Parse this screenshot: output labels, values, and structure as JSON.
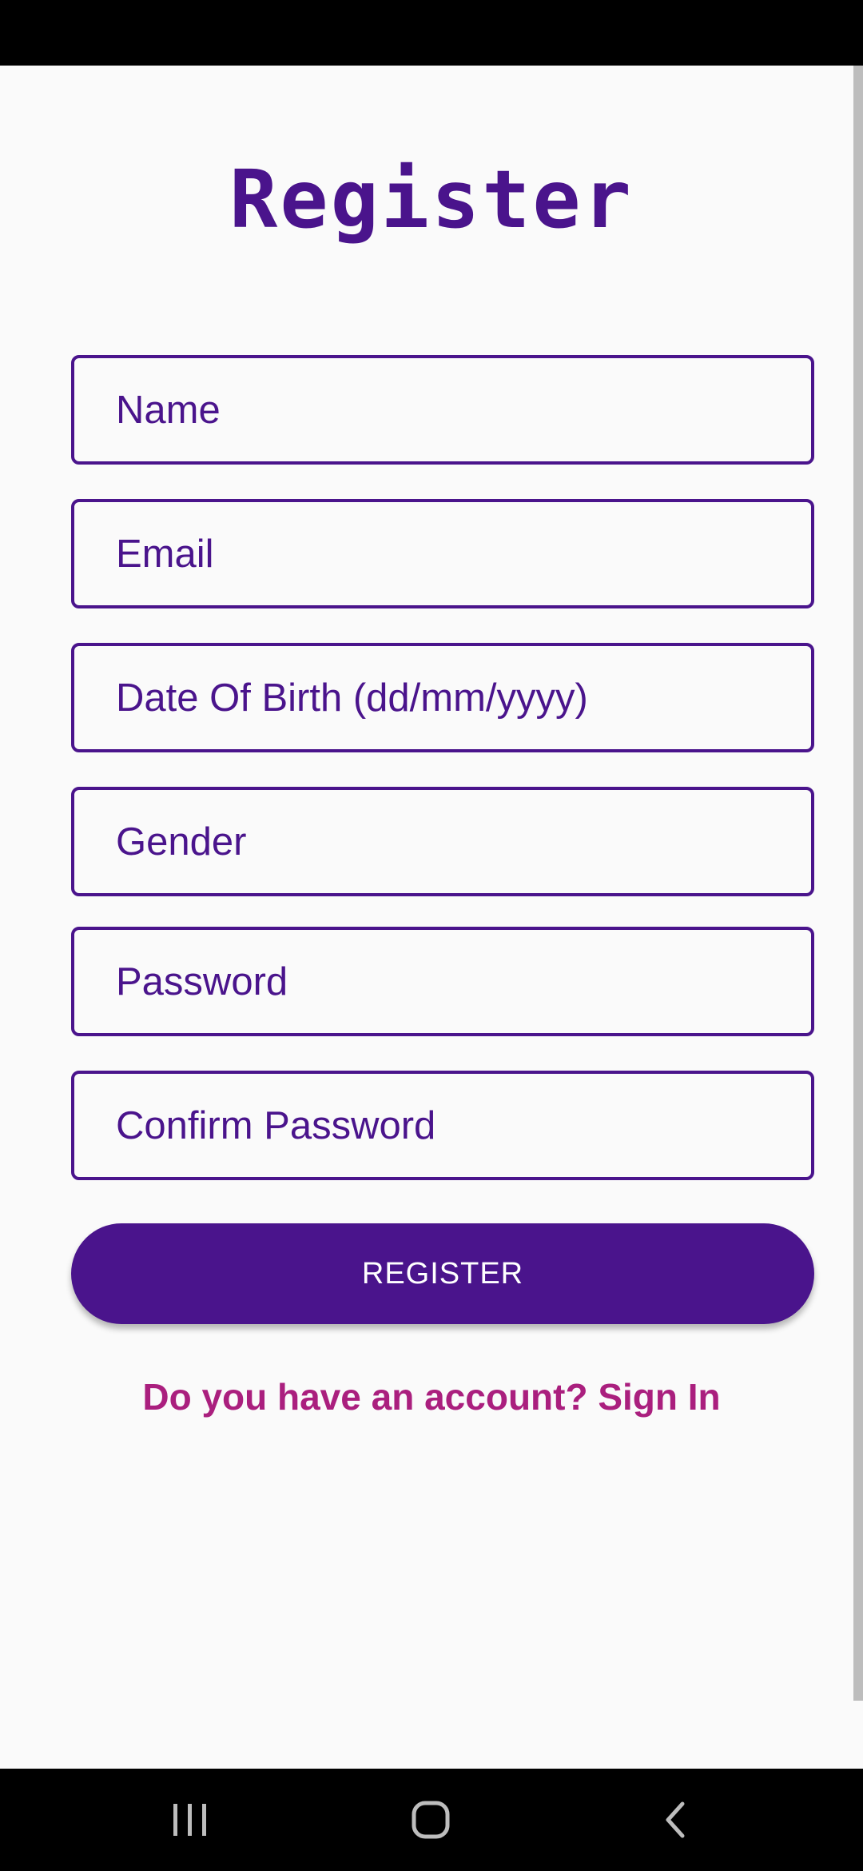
{
  "page": {
    "title": "Register"
  },
  "form": {
    "fields": [
      {
        "id": "name",
        "placeholder": "Name"
      },
      {
        "id": "email",
        "placeholder": "Email"
      },
      {
        "id": "dob",
        "placeholder": "Date Of Birth (dd/mm/yyyy)"
      },
      {
        "id": "gender",
        "placeholder": "Gender"
      },
      {
        "id": "password",
        "placeholder": "Password"
      },
      {
        "id": "confirm_password",
        "placeholder": "Confirm Password"
      }
    ],
    "submit_label": "REGISTER",
    "signin_prompt": "Do you have an account? Sign In"
  },
  "navigation": {
    "recents_icon": "recent-apps-icon",
    "home_icon": "home-icon",
    "back_icon": "back-icon"
  },
  "colors": {
    "primary": "#4a148c",
    "link": "#aa1f7e",
    "background": "#fafafa",
    "button_text": "#ffffff"
  }
}
